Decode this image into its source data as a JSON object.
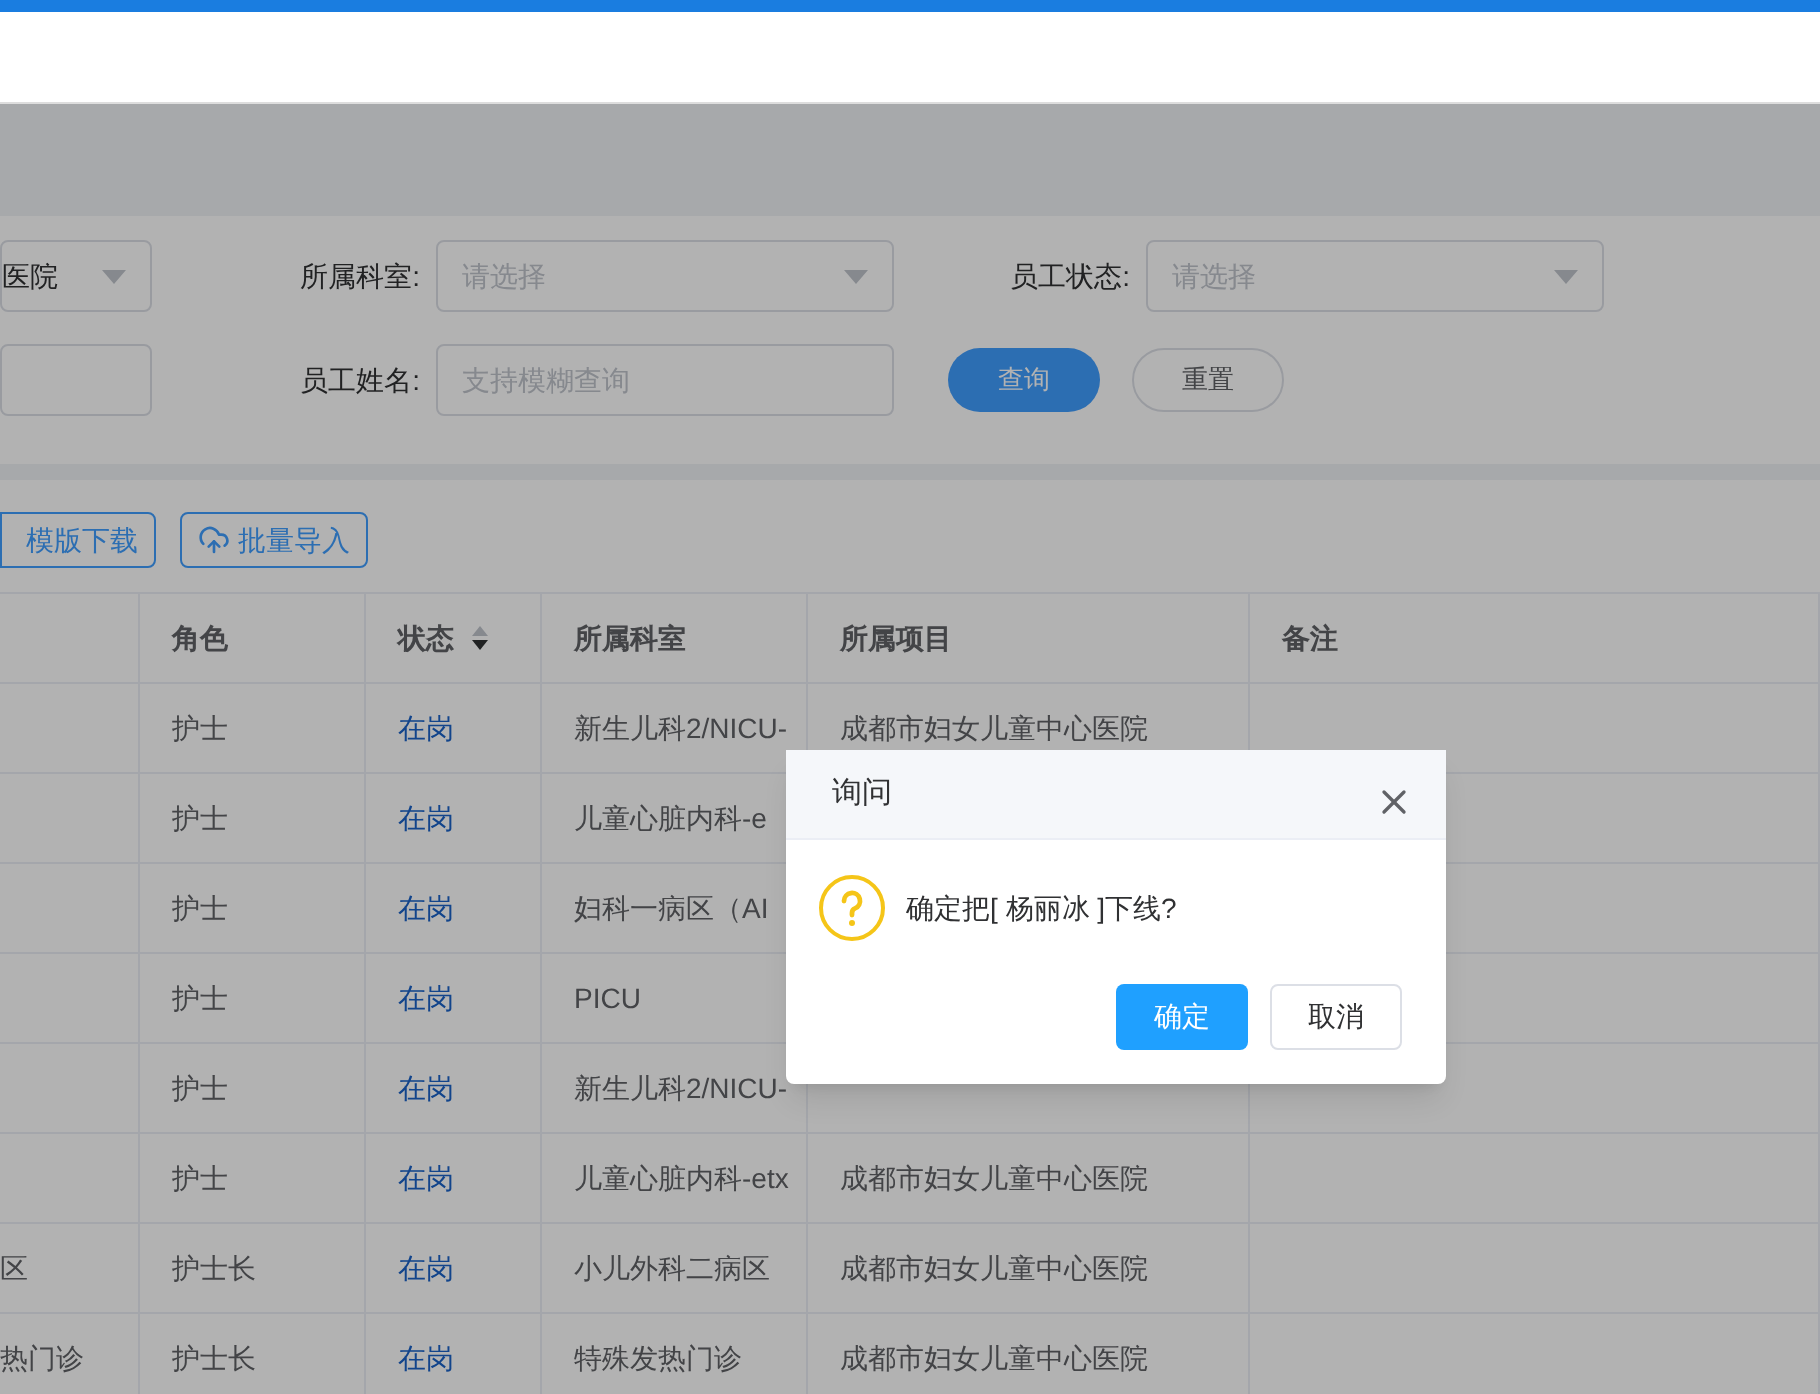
{
  "filters": [
    {
      "kind": "select",
      "value": "医院"
    },
    {
      "kind": "select",
      "label": "所属科室:",
      "placeholder": "请选择"
    },
    {
      "kind": "select",
      "label": "员工状态:",
      "placeholder": "请选择"
    },
    {
      "kind": "input"
    },
    {
      "kind": "input",
      "label": "员工姓名:",
      "placeholder": "支持模糊查询"
    }
  ],
  "filter_buttons": [
    {
      "label": "查询",
      "kind": "primary"
    },
    {
      "label": "重置",
      "kind": "default"
    }
  ],
  "toolbar": [
    {
      "label": "模版下载",
      "kind": "download"
    },
    {
      "label": "批量导入",
      "kind": "upload"
    }
  ],
  "table": {
    "columns": [
      {
        "sortable": false
      },
      {
        "label": "角色",
        "sortable": false
      },
      {
        "label": "状态",
        "sortable": true
      },
      {
        "label": "所属科室",
        "sortable": false
      },
      {
        "label": "所属项目",
        "sortable": false
      },
      {
        "label": "备注",
        "sortable": false
      }
    ],
    "rows": [
      [
        null,
        "护士",
        "在岗",
        "新生儿科2/NICU-",
        "成都市妇女儿童中心医院",
        null
      ],
      [
        null,
        "护士",
        "在岗",
        "儿童心脏内科-e",
        null,
        null
      ],
      [
        null,
        "护士",
        "在岗",
        "妇科一病区（AI",
        null,
        null
      ],
      [
        null,
        "护士",
        "在岗",
        "PICU",
        null,
        null
      ],
      [
        null,
        "护士",
        "在岗",
        "新生儿科2/NICU-",
        null,
        null
      ],
      [
        null,
        "护士",
        "在岗",
        "儿童心脏内科-etx",
        "成都市妇女儿童中心医院",
        null
      ],
      [
        "区",
        "护士长",
        "在岗",
        "小儿外科二病区",
        "成都市妇女儿童中心医院",
        null
      ],
      [
        "热门诊",
        "护士长",
        "在岗",
        "特殊发热门诊",
        "成都市妇女儿童中心医院",
        null
      ]
    ]
  },
  "dialog": {
    "title": "询问",
    "message": "确定把[ 杨丽冰 ]下线?",
    "buttons": [
      {
        "label": "确定",
        "kind": "primary"
      },
      {
        "label": "取消",
        "kind": "default"
      }
    ]
  }
}
